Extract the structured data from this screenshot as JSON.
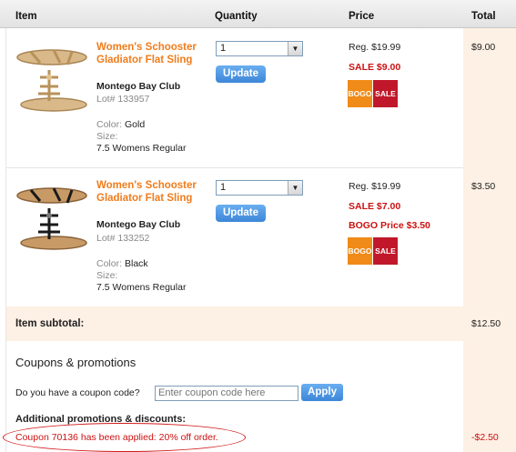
{
  "header": {
    "item": "Item",
    "quantity": "Quantity",
    "price": "Price",
    "total": "Total"
  },
  "items": [
    {
      "title": "Women's Schooster Gladiator Flat Sling",
      "brand": "Montego Bay Club",
      "lot": "Lot# 133957",
      "color_label": "Color:",
      "color": "Gold",
      "size_label": "Size:",
      "size": "7.5 Womens Regular",
      "quantity": "1",
      "update": "Update",
      "reg": "Reg. $19.99",
      "sale": "SALE $9.00",
      "bogo_price": "",
      "badge_bogo": "BOGO",
      "badge_sale": "SALE",
      "total": "$9.00",
      "sandal_color": "#c9a46a",
      "strap_color": "#b8925a"
    },
    {
      "title": "Women's Schooster Gladiator Flat Sling",
      "brand": "Montego Bay Club",
      "lot": "Lot# 133252",
      "color_label": "Color:",
      "color": "Black",
      "size_label": "Size:",
      "size": "7.5 Womens Regular",
      "quantity": "1",
      "update": "Update",
      "reg": "Reg. $19.99",
      "sale": "SALE $7.00",
      "bogo_price": "BOGO Price $3.50",
      "badge_bogo": "BOGO",
      "badge_sale": "SALE",
      "total": "$3.50",
      "sandal_color": "#b98a58",
      "strap_color": "#1a1a1a"
    }
  ],
  "subtotal": {
    "label": "Item subtotal:",
    "value": "$12.50"
  },
  "coupons": {
    "heading": "Coupons & promotions",
    "question": "Do you have a coupon code?",
    "placeholder": "Enter coupon code here",
    "apply": "Apply"
  },
  "promotions": {
    "heading": "Additional promotions & discounts:",
    "message": "Coupon 70136 has been applied: 20% off order.",
    "discount": "-$2.50"
  },
  "colors": {
    "accent_orange": "#f07c1c",
    "sale_red": "#cc1111",
    "button_blue": "#4a90e2",
    "total_bg": "#fdf0e4"
  }
}
